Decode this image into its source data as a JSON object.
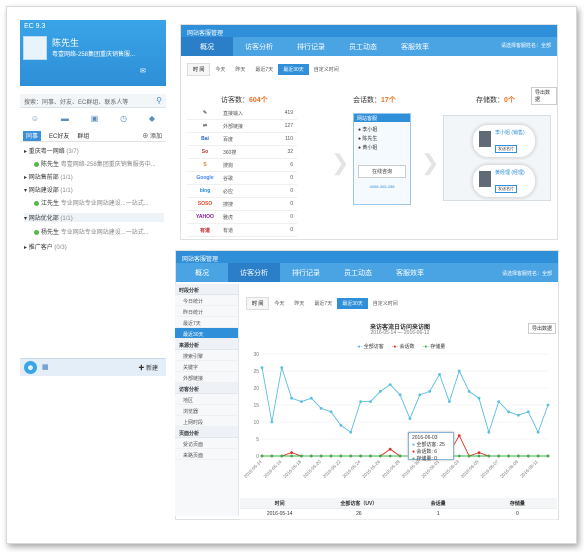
{
  "im": {
    "title": "EC 9.3",
    "user_name": "陈先生",
    "signature": "粤壹网络-258集团重庆销售服...",
    "search_placeholder": "搜索：同事、好友、EC群组、联系人等",
    "tabs": [
      "同事",
      "EC好友",
      "群组"
    ],
    "add_label": "添加",
    "groups": [
      {
        "label": "重庆粤一网络",
        "count": "(3/7)"
      },
      {
        "label": "网站售前部",
        "count": "(1/1)"
      },
      {
        "label": "网站建设部",
        "count": "(1/1)"
      },
      {
        "label": "网站优化部",
        "count": "(1/1)"
      },
      {
        "label": "推广客户",
        "count": "(0/3)"
      }
    ],
    "members": [
      {
        "name": "陈先生",
        "sub": "粤壹网络-258集团重庆销售服务中..."
      },
      {
        "name": "江先生",
        "sub": "专业网站专业网站建设...一站式..."
      },
      {
        "name": "杨先生",
        "sub": "专业网站专业网站建设...一站式..."
      }
    ],
    "bottom_new": "新建"
  },
  "db1": {
    "title": "网站客服管理",
    "nav": [
      "概况",
      "访客分析",
      "排行记录",
      "员工动态",
      "客服效率"
    ],
    "user": "请选择客服姓名：全部",
    "time_label": "时 间",
    "ranges": [
      "今天",
      "昨天",
      "最近7天",
      "最近30天",
      "自定义时间"
    ],
    "active_range": "最近30天",
    "visitors_label": "访客数：",
    "visitors": "604个",
    "sessions_label": "会话数：",
    "sessions": "17个",
    "leads_label": "存储数：",
    "leads": "0个",
    "export": "导出数据",
    "sources": [
      {
        "icon": "✎",
        "name": "直接输入",
        "value": "419"
      },
      {
        "icon": "⇄",
        "name": "外部链接",
        "value": "127"
      },
      {
        "icon": "Bai",
        "name": "百度",
        "value": "110"
      },
      {
        "icon": "So",
        "name": "360搜",
        "value": "32"
      },
      {
        "icon": "S",
        "name": "搜狗",
        "value": "6"
      },
      {
        "icon": "Google",
        "name": "谷歌",
        "value": "0"
      },
      {
        "icon": "bing",
        "name": "必应",
        "value": "0"
      },
      {
        "icon": "SOSO",
        "name": "搜搜",
        "value": "0"
      },
      {
        "icon": "YAHOO",
        "name": "雅虎",
        "value": "0"
      },
      {
        "icon": "有道",
        "name": "有道",
        "value": "0"
      }
    ],
    "chat_header": "网站客服",
    "chat_items": [
      "李小姐",
      "陈先生",
      "黄小姐"
    ],
    "chat_btn": "在线咨询",
    "chat_phone": "4008-305-258",
    "card1_name": "李小姐 (销售)",
    "card1_btn": "发送名片",
    "card2_name": "黄经理 (经理)",
    "card2_btn": "发送名片"
  },
  "db2": {
    "title": "网站客服管理",
    "nav": [
      "概况",
      "访客分析",
      "排行记录",
      "员工动态",
      "客服效率"
    ],
    "user": "请选择客服姓名：全部",
    "time_label": "时 间",
    "ranges": [
      "今天",
      "昨天",
      "最近7天",
      "最近30天",
      "自定义时间"
    ],
    "active_range": "最近30天",
    "export": "导出数据",
    "side": [
      {
        "head": "时段分析",
        "items": [
          "今日统计",
          "昨日统计",
          "最近7天",
          "最近30天"
        ],
        "active": "最近30天"
      },
      {
        "head": "来源分析",
        "items": [
          "搜索引擎",
          "关键字",
          "外部链接"
        ]
      },
      {
        "head": "访客分析",
        "items": [
          "地区",
          "浏览器",
          "上网时段"
        ]
      },
      {
        "head": "页面分析",
        "items": [
          "受访页面",
          "来路页面"
        ]
      }
    ],
    "chart_title": "来访客流日访问来访图",
    "chart_sub": "2016-05-14   —   2016-06-12",
    "tooltip_date": "2016-06-03",
    "tooltip_rows": [
      {
        "label": "全部访客",
        "value": "25"
      },
      {
        "label": "会话数",
        "value": "6"
      },
      {
        "label": "存储量",
        "value": "0"
      }
    ],
    "table_headers": [
      "时间",
      "全部访客（UV）",
      "会话量",
      "存储量"
    ],
    "table_row": [
      "2016-05-14",
      "26",
      "1",
      "0"
    ]
  },
  "colors": {
    "accent": "#2f8fd8",
    "visitors": "#5bbfe0",
    "sessions": "#d9342b",
    "leads": "#3fae4a"
  },
  "chart_data": {
    "type": "line",
    "title": "来访客流日访问来访图",
    "subtitle": "2016-05-14 — 2016-06-12",
    "x": [
      "2016-05-14",
      "2016-05-15",
      "2016-05-16",
      "2016-05-17",
      "2016-05-18",
      "2016-05-19",
      "2016-05-20",
      "2016-05-21",
      "2016-05-22",
      "2016-05-23",
      "2016-05-24",
      "2016-05-25",
      "2016-05-26",
      "2016-05-27",
      "2016-05-28",
      "2016-05-29",
      "2016-05-30",
      "2016-05-31",
      "2016-06-01",
      "2016-06-02",
      "2016-06-03",
      "2016-06-04",
      "2016-06-05",
      "2016-06-06",
      "2016-06-07",
      "2016-06-08",
      "2016-06-09",
      "2016-06-10",
      "2016-06-11",
      "2016-06-12"
    ],
    "series": [
      {
        "name": "全部访客",
        "values": [
          26,
          10,
          26,
          17,
          16,
          17,
          14,
          13,
          9,
          7,
          16,
          16,
          19,
          21,
          18,
          11,
          18,
          19,
          24,
          16,
          25,
          19,
          17,
          7,
          16,
          13,
          12,
          13,
          7,
          15
        ]
      },
      {
        "name": "会话数",
        "values": [
          0,
          0,
          0,
          1,
          0,
          0,
          0,
          0,
          0,
          0,
          0,
          0,
          0,
          2,
          0,
          0,
          1,
          1,
          0,
          1,
          6,
          0,
          1,
          0,
          0,
          0,
          0,
          0,
          0,
          0
        ]
      },
      {
        "name": "存储量",
        "values": [
          0,
          0,
          0,
          0,
          0,
          0,
          0,
          0,
          0,
          0,
          0,
          0,
          0,
          0,
          0,
          0,
          0,
          0,
          0,
          0,
          0,
          0,
          0,
          0,
          0,
          0,
          0,
          0,
          0,
          0
        ]
      }
    ],
    "ylim": [
      0,
      30
    ],
    "yticks": [
      0,
      5,
      10,
      15,
      20,
      25,
      30
    ],
    "legend": "top-center",
    "grid": true
  }
}
